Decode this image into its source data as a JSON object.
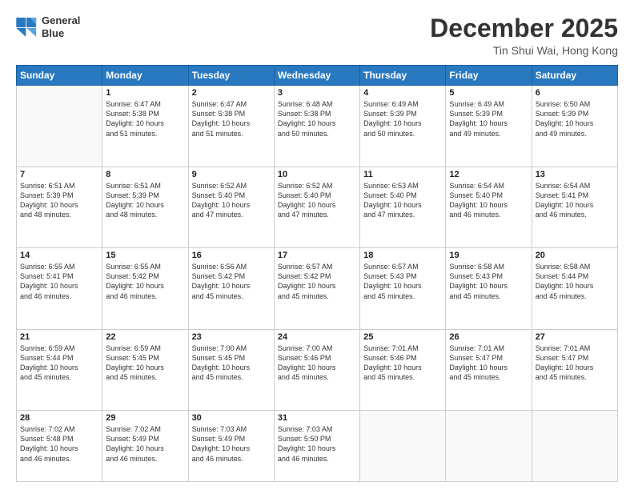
{
  "header": {
    "logo_line1": "General",
    "logo_line2": "Blue",
    "title": "December 2025",
    "subtitle": "Tin Shui Wai, Hong Kong"
  },
  "weekdays": [
    "Sunday",
    "Monday",
    "Tuesday",
    "Wednesday",
    "Thursday",
    "Friday",
    "Saturday"
  ],
  "weeks": [
    [
      {
        "day": "",
        "info": ""
      },
      {
        "day": "1",
        "info": "Sunrise: 6:47 AM\nSunset: 5:38 PM\nDaylight: 10 hours\nand 51 minutes."
      },
      {
        "day": "2",
        "info": "Sunrise: 6:47 AM\nSunset: 5:38 PM\nDaylight: 10 hours\nand 51 minutes."
      },
      {
        "day": "3",
        "info": "Sunrise: 6:48 AM\nSunset: 5:38 PM\nDaylight: 10 hours\nand 50 minutes."
      },
      {
        "day": "4",
        "info": "Sunrise: 6:49 AM\nSunset: 5:39 PM\nDaylight: 10 hours\nand 50 minutes."
      },
      {
        "day": "5",
        "info": "Sunrise: 6:49 AM\nSunset: 5:39 PM\nDaylight: 10 hours\nand 49 minutes."
      },
      {
        "day": "6",
        "info": "Sunrise: 6:50 AM\nSunset: 5:39 PM\nDaylight: 10 hours\nand 49 minutes."
      }
    ],
    [
      {
        "day": "7",
        "info": "Sunrise: 6:51 AM\nSunset: 5:39 PM\nDaylight: 10 hours\nand 48 minutes."
      },
      {
        "day": "8",
        "info": "Sunrise: 6:51 AM\nSunset: 5:39 PM\nDaylight: 10 hours\nand 48 minutes."
      },
      {
        "day": "9",
        "info": "Sunrise: 6:52 AM\nSunset: 5:40 PM\nDaylight: 10 hours\nand 47 minutes."
      },
      {
        "day": "10",
        "info": "Sunrise: 6:52 AM\nSunset: 5:40 PM\nDaylight: 10 hours\nand 47 minutes."
      },
      {
        "day": "11",
        "info": "Sunrise: 6:53 AM\nSunset: 5:40 PM\nDaylight: 10 hours\nand 47 minutes."
      },
      {
        "day": "12",
        "info": "Sunrise: 6:54 AM\nSunset: 5:40 PM\nDaylight: 10 hours\nand 46 minutes."
      },
      {
        "day": "13",
        "info": "Sunrise: 6:54 AM\nSunset: 5:41 PM\nDaylight: 10 hours\nand 46 minutes."
      }
    ],
    [
      {
        "day": "14",
        "info": "Sunrise: 6:55 AM\nSunset: 5:41 PM\nDaylight: 10 hours\nand 46 minutes."
      },
      {
        "day": "15",
        "info": "Sunrise: 6:55 AM\nSunset: 5:42 PM\nDaylight: 10 hours\nand 46 minutes."
      },
      {
        "day": "16",
        "info": "Sunrise: 6:56 AM\nSunset: 5:42 PM\nDaylight: 10 hours\nand 45 minutes."
      },
      {
        "day": "17",
        "info": "Sunrise: 6:57 AM\nSunset: 5:42 PM\nDaylight: 10 hours\nand 45 minutes."
      },
      {
        "day": "18",
        "info": "Sunrise: 6:57 AM\nSunset: 5:43 PM\nDaylight: 10 hours\nand 45 minutes."
      },
      {
        "day": "19",
        "info": "Sunrise: 6:58 AM\nSunset: 5:43 PM\nDaylight: 10 hours\nand 45 minutes."
      },
      {
        "day": "20",
        "info": "Sunrise: 6:58 AM\nSunset: 5:44 PM\nDaylight: 10 hours\nand 45 minutes."
      }
    ],
    [
      {
        "day": "21",
        "info": "Sunrise: 6:59 AM\nSunset: 5:44 PM\nDaylight: 10 hours\nand 45 minutes."
      },
      {
        "day": "22",
        "info": "Sunrise: 6:59 AM\nSunset: 5:45 PM\nDaylight: 10 hours\nand 45 minutes."
      },
      {
        "day": "23",
        "info": "Sunrise: 7:00 AM\nSunset: 5:45 PM\nDaylight: 10 hours\nand 45 minutes."
      },
      {
        "day": "24",
        "info": "Sunrise: 7:00 AM\nSunset: 5:46 PM\nDaylight: 10 hours\nand 45 minutes."
      },
      {
        "day": "25",
        "info": "Sunrise: 7:01 AM\nSunset: 5:46 PM\nDaylight: 10 hours\nand 45 minutes."
      },
      {
        "day": "26",
        "info": "Sunrise: 7:01 AM\nSunset: 5:47 PM\nDaylight: 10 hours\nand 45 minutes."
      },
      {
        "day": "27",
        "info": "Sunrise: 7:01 AM\nSunset: 5:47 PM\nDaylight: 10 hours\nand 45 minutes."
      }
    ],
    [
      {
        "day": "28",
        "info": "Sunrise: 7:02 AM\nSunset: 5:48 PM\nDaylight: 10 hours\nand 46 minutes."
      },
      {
        "day": "29",
        "info": "Sunrise: 7:02 AM\nSunset: 5:49 PM\nDaylight: 10 hours\nand 46 minutes."
      },
      {
        "day": "30",
        "info": "Sunrise: 7:03 AM\nSunset: 5:49 PM\nDaylight: 10 hours\nand 46 minutes."
      },
      {
        "day": "31",
        "info": "Sunrise: 7:03 AM\nSunset: 5:50 PM\nDaylight: 10 hours\nand 46 minutes."
      },
      {
        "day": "",
        "info": ""
      },
      {
        "day": "",
        "info": ""
      },
      {
        "day": "",
        "info": ""
      }
    ]
  ]
}
